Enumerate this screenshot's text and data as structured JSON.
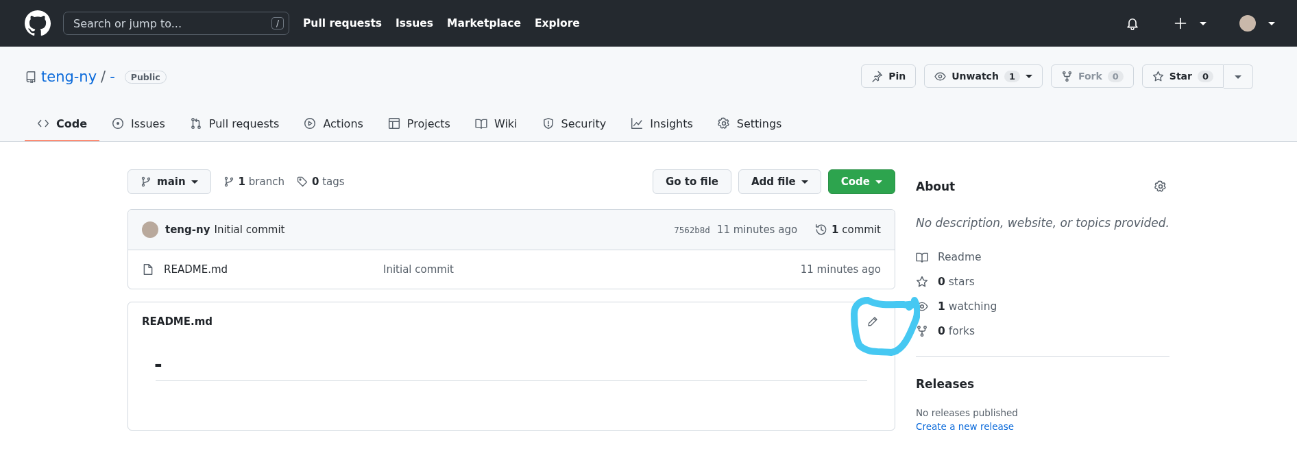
{
  "top_bar": {
    "search": {
      "placeholder": "Search or jump to...",
      "shortcut": "/"
    },
    "nav": [
      "Pull requests",
      "Issues",
      "Marketplace",
      "Explore"
    ]
  },
  "repo": {
    "owner": "teng-ny",
    "separator": "/",
    "name": "-",
    "visibility": "Public",
    "actions": [
      {
        "label": "Pin",
        "disabled": false
      },
      {
        "label": "Unwatch",
        "count": "1",
        "disabled": false
      },
      {
        "label": "Fork",
        "count": "0",
        "disabled": true
      },
      {
        "label": "Star",
        "count": "0",
        "disabled": false
      }
    ]
  },
  "tabs": [
    {
      "label": "Code",
      "selected": true
    },
    {
      "label": "Issues",
      "selected": false
    },
    {
      "label": "Pull requests",
      "selected": false
    },
    {
      "label": "Actions",
      "selected": false
    },
    {
      "label": "Projects",
      "selected": false
    },
    {
      "label": "Wiki",
      "selected": false
    },
    {
      "label": "Security",
      "selected": false
    },
    {
      "label": "Insights",
      "selected": false
    },
    {
      "label": "Settings",
      "selected": false
    }
  ],
  "branch_bar": {
    "branch": "main",
    "branches": "**1** branch",
    "tags": "**0** tags",
    "buttons": [
      "Go to file",
      "Add file",
      "Code"
    ]
  },
  "commit": {
    "author": "teng-ny",
    "message": "Initial commit",
    "sha": "7562b8d",
    "time": "11 minutes ago",
    "commits": "**1** commit"
  },
  "files": [
    {
      "name": "README.md",
      "message": "Initial commit",
      "time": "11 minutes ago"
    }
  ],
  "readme": {
    "title": "README.md",
    "heading": "-"
  },
  "about": {
    "title": "About",
    "description": "No description, website, or topics provided.",
    "items": [
      "Readme",
      "**0** stars",
      "**1** watching",
      "**0** forks"
    ]
  },
  "releases": {
    "title": "Releases",
    "text": "No releases published",
    "link": "Create a new release"
  }
}
